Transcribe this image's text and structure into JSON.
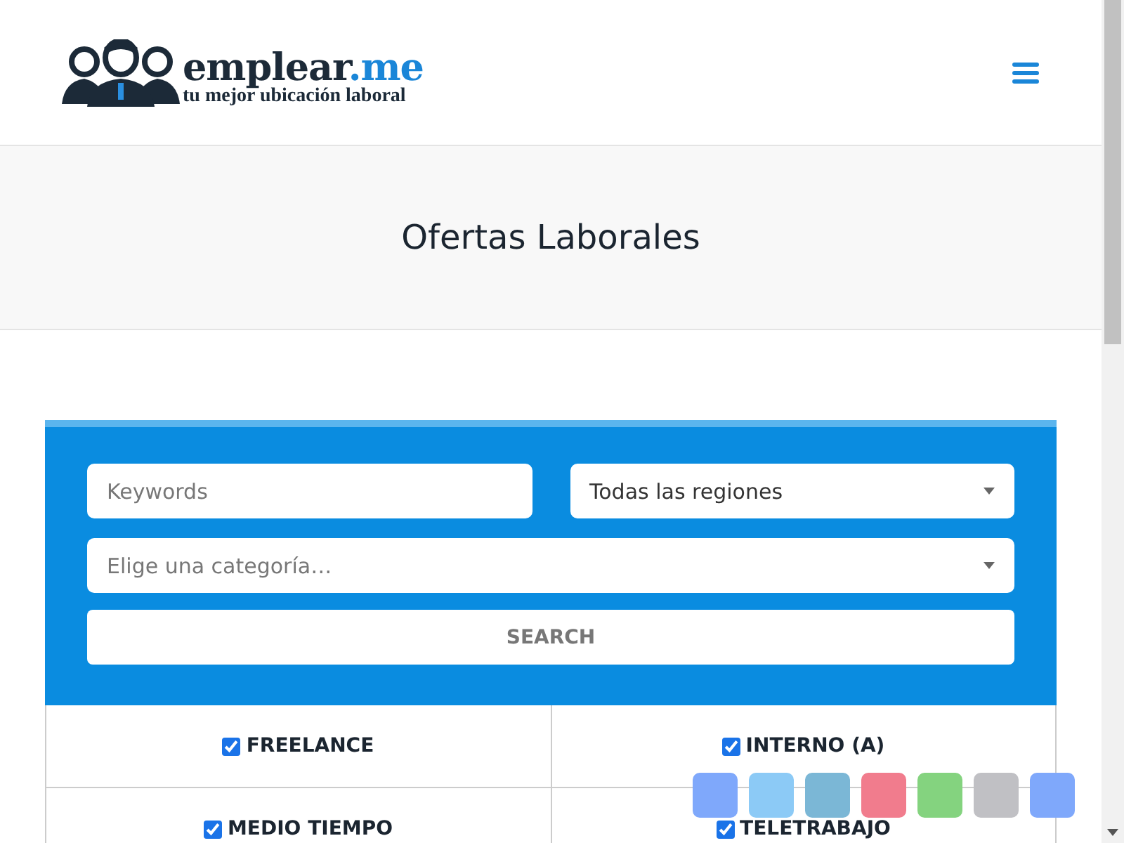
{
  "logo": {
    "name": "emplear",
    "tld": ".me",
    "tagline": "tu mejor ubicación laboral"
  },
  "page_title": "Ofertas Laborales",
  "search": {
    "keywords": {
      "placeholder": "Keywords"
    },
    "region": {
      "value": "Todas las regiones"
    },
    "category": {
      "placeholder": "Elige una categoría…"
    },
    "button": "SEARCH"
  },
  "job_types": [
    {
      "label": "FREELANCE",
      "checked": true
    },
    {
      "label": "INTERNO (A)",
      "checked": true
    },
    {
      "label": "MEDIO TIEMPO",
      "checked": true
    },
    {
      "label": "TELETRABAJO",
      "checked": true
    }
  ],
  "share_buttons": [
    {
      "color": "#7fa8fb"
    },
    {
      "color": "#8ccaf6"
    },
    {
      "color": "#7bb7d6"
    },
    {
      "color": "#f17c8d"
    },
    {
      "color": "#84d37f"
    },
    {
      "color": "#c0c0c4"
    },
    {
      "color": "#7fa8fb"
    }
  ]
}
